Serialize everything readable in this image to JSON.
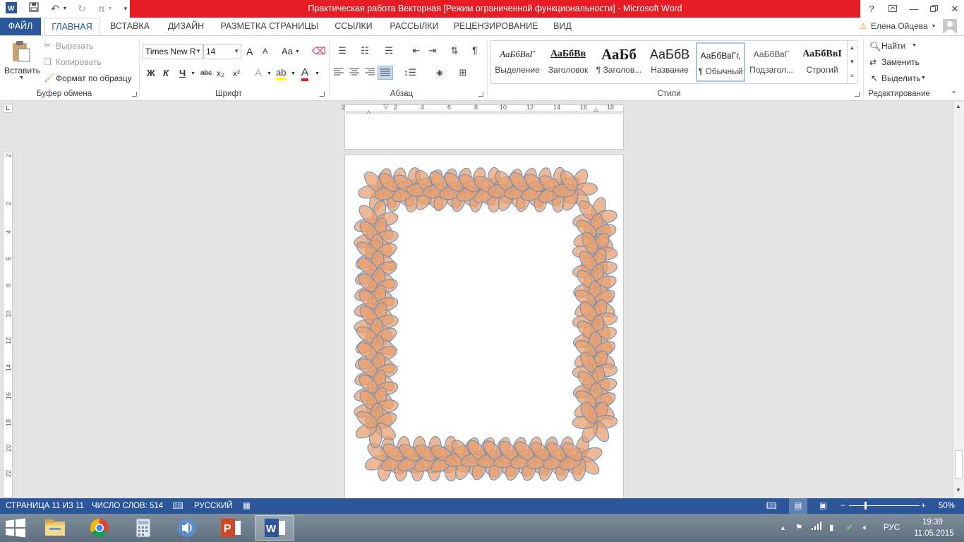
{
  "window": {
    "title": "Практическая работа Векторная [Режим ограниченной функциональности] -  Microsoft Word",
    "help": "?",
    "colors": {
      "title_accent": "#e51c23",
      "brand": "#2b579a",
      "flower_fill": "#e8a070",
      "flower_stroke": "#5b8fc9"
    }
  },
  "ribbon_tabs": [
    "ФАЙЛ",
    "ГЛАВНАЯ",
    "ВСТАВКА",
    "ДИЗАЙН",
    "РАЗМЕТКА СТРАНИЦЫ",
    "ССЫЛКИ",
    "РАССЫЛКИ",
    "РЕЦЕНЗИРОВАНИЕ",
    "ВИД"
  ],
  "user": {
    "name": "Елена Ойцева"
  },
  "clipboard": {
    "paste": "Вставить",
    "cut": "Вырезать",
    "copy": "Копировать",
    "format_painter": "Формат по образцу",
    "label": "Буфер обмена"
  },
  "font": {
    "name": "Times New R",
    "size": "14",
    "bold": "Ж",
    "italic": "К",
    "underline": "Ч",
    "strike": "abc",
    "sub": "x₂",
    "sup": "x²",
    "grow": "A",
    "shrink": "A",
    "case": "Aa",
    "label": "Шрифт"
  },
  "paragraph": {
    "label": "Абзац",
    "pilcrow": "¶"
  },
  "styles": {
    "label": "Стили",
    "items": [
      {
        "preview": "АаБбВвГ",
        "name": "Выделение"
      },
      {
        "preview": "АаБбВв",
        "name": "Заголовок"
      },
      {
        "preview": "АаБб",
        "name": "¶ Заголов..."
      },
      {
        "preview": "АаБбВ",
        "name": "Название"
      },
      {
        "preview": "АаБбВвГг,",
        "name": "¶ Обычный"
      },
      {
        "preview": "АаБбВвГ",
        "name": "Подзагол..."
      },
      {
        "preview": "АаБбВвI",
        "name": "Строгий"
      }
    ]
  },
  "editing": {
    "find": "Найти",
    "replace": "Заменить",
    "select": "Выделить",
    "label": "Редактирование"
  },
  "ruler": {
    "h_ticks": [
      "2",
      "2",
      "4",
      "6",
      "8",
      "10",
      "12",
      "14",
      "16",
      "18"
    ],
    "v_ticks": [
      "2",
      "2",
      "4",
      "6",
      "8",
      "10",
      "12",
      "14",
      "16",
      "18",
      "20",
      "22"
    ]
  },
  "status": {
    "page": "СТРАНИЦА 11 ИЗ 11",
    "words": "ЧИСЛО СЛОВ: 514",
    "language": "РУССКИЙ",
    "zoom": "50%"
  },
  "taskbar": {
    "apps": [
      "explorer",
      "chrome",
      "calculator",
      "sound-recorder",
      "powerpoint",
      "word"
    ],
    "lang": "РУС",
    "time": "19:39",
    "date": "11.05.2015"
  }
}
